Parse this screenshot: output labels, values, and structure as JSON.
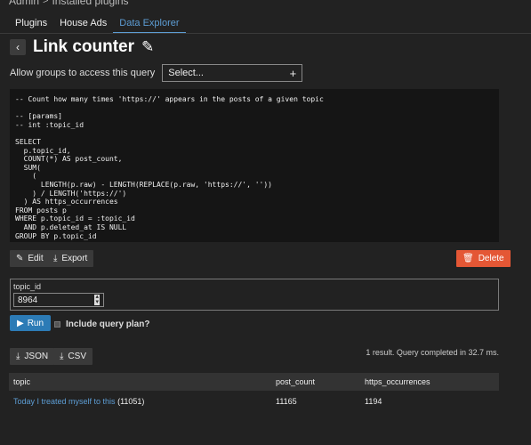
{
  "breadcrumb": {
    "root": "Admin",
    "separator": ">",
    "current": "Installed plugins"
  },
  "tabs": [
    {
      "label": "Plugins",
      "active": false
    },
    {
      "label": "House Ads",
      "active": false
    },
    {
      "label": "Data Explorer",
      "active": true
    }
  ],
  "header": {
    "back_icon": "chevron-left-icon",
    "title": "Link counter",
    "edit_icon": "pencil-icon"
  },
  "groups": {
    "label": "Allow groups to access this query",
    "select_value": "Select...",
    "add_glyph": "+"
  },
  "query": {
    "sql": "-- Count how many times 'https://' appears in the posts of a given topic\n\n-- [params]\n-- int :topic_id\n\nSELECT\n  p.topic_id,\n  COUNT(*) AS post_count,\n  SUM(\n    (\n      LENGTH(p.raw) - LENGTH(REPLACE(p.raw, 'https://', ''))\n    ) / LENGTH('https://')\n  ) AS https_occurrences\nFROM posts p\nWHERE p.topic_id = :topic_id\n  AND p.deleted_at IS NULL\nGROUP BY p.topic_id"
  },
  "actions": {
    "edit_label": "Edit",
    "export_label": "Export",
    "delete_label": "Delete"
  },
  "params": {
    "label": "topic_id",
    "value": "8964"
  },
  "run": {
    "label": "Run",
    "include_plan_label": "Include query plan?"
  },
  "downloads": {
    "json_label": "JSON",
    "csv_label": "CSV"
  },
  "result_summary": "1 result. Query completed in 32.7 ms.",
  "table": {
    "headers": [
      "topic",
      "post_count",
      "https_occurrences"
    ],
    "rows": [
      {
        "topic_title": "Today I treated myself to this",
        "topic_id": "(11051)",
        "post_count": "11165",
        "https_occurrences": "1194"
      }
    ]
  },
  "colors": {
    "accent": "#5d9dd4",
    "danger": "#e45735",
    "run": "#2c7bb6",
    "background": "#222222"
  }
}
